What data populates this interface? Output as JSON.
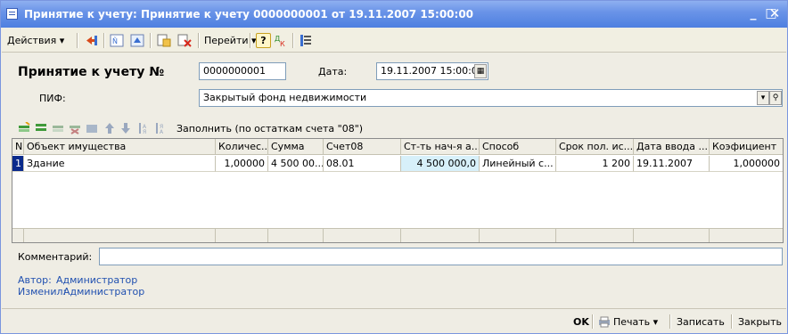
{
  "window": {
    "title": "Принятие к учету: Принятие к учету 0000000001 от 19.11.2007 15:00:00",
    "minimize_glyph": "_",
    "maximize_glyph": "□",
    "close_glyph": "✕"
  },
  "toolbar": {
    "actions_label": "Действия ▾",
    "goto_label": "Перейти ▾",
    "help_glyph": "?",
    "icons": [
      "arrow-left-icon",
      "dt-kt-icon",
      "refresh-icon",
      "copy-doc-icon",
      "delete-doc-icon",
      "help-icon",
      "dt-kt-colored-icon",
      "structure-icon"
    ]
  },
  "form": {
    "doc_label": "Принятие к учету №",
    "doc_number": "0000000001",
    "date_label": "Дата:",
    "date_value": "19.11.2007 15:00:0",
    "pif_label": "ПИФ:",
    "pif_value": "Закрытый фонд недвижимости",
    "fill_label": "Заполнить (по остаткам счета \"08\")",
    "comment_label": "Комментарий:",
    "comment_value": ""
  },
  "table": {
    "headers": [
      "N",
      "Объект имущества",
      "Количес...",
      "Сумма",
      "Счет08",
      "Ст-ть нач-я а...",
      "Способ",
      "Срок пол. ис...",
      "Дата ввода ...",
      "Коэфициент"
    ],
    "rows": [
      [
        "1",
        "Здание",
        "1,00000",
        "4 500 00...",
        "08.01",
        "4 500 000,0",
        "Линейный с...",
        "1 200",
        "19.11.2007",
        "1,000000"
      ]
    ]
  },
  "info": {
    "author_label": "Автор:",
    "author_value": "Администратор",
    "changed_label": "Изменил:",
    "changed_value": "Администратор"
  },
  "bottom": {
    "ok_label": "OK",
    "print_label": "Печать ▾",
    "save_label": "Записать",
    "close_label": "Закрыть"
  },
  "colors": {
    "titlebar": "#4e7fe0",
    "selection": "#0a2a8c",
    "highlight_cell": "#d7f0fa",
    "link": "#2050b0"
  }
}
